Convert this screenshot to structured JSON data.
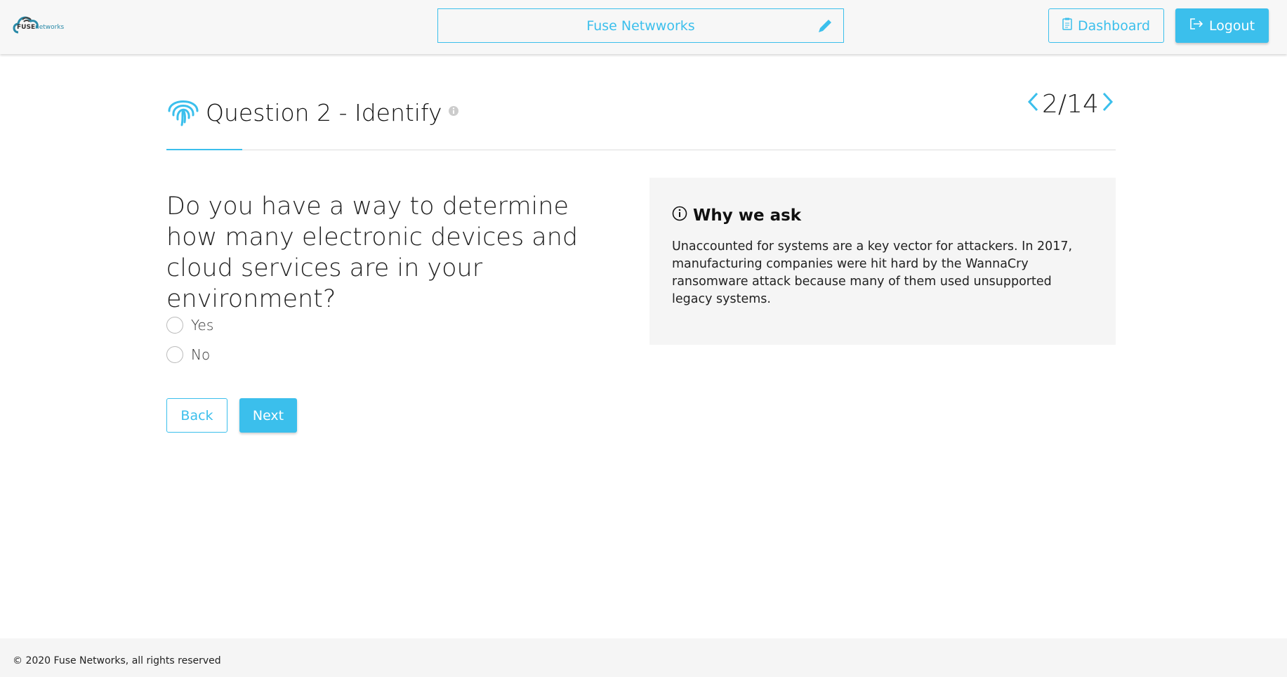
{
  "header": {
    "logo_text": "FUSE networks",
    "title": "Fuse Netwworks",
    "dashboard_label": "Dashboard",
    "logout_label": "Logout"
  },
  "question": {
    "title": "Question 2 - Identify",
    "progress": "2/14",
    "current": 2,
    "total": 14,
    "text": "Do you have a way to determine how many electronic devices and cloud services are in your environment?",
    "options": [
      "Yes",
      "No"
    ],
    "back_label": "Back",
    "next_label": "Next"
  },
  "why": {
    "heading": "Why we ask",
    "text": "Unaccounted for systems are a key vector for attackers. In 2017, manufacturing companies were hit hard by the WannaCry ransomware attack because many of them used unsupported legacy systems."
  },
  "footer": {
    "text": "© 2020 Fuse Networks, all rights reserved"
  },
  "colors": {
    "accent": "#3bbfec"
  }
}
